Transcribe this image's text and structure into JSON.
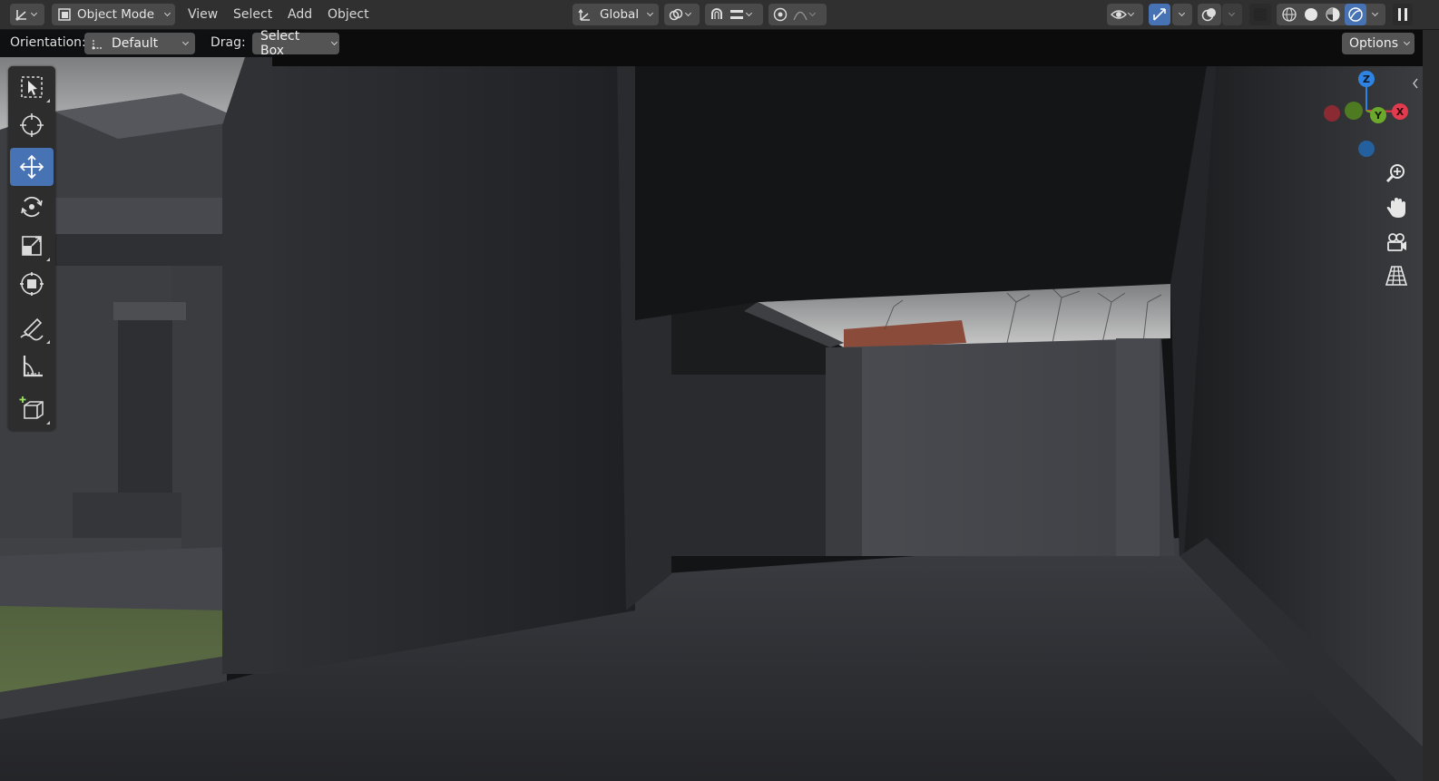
{
  "header": {
    "editor_type_icon": "axes-icon",
    "mode": "Object Mode",
    "menus": [
      "View",
      "Select",
      "Add",
      "Object"
    ],
    "transform_orientation": "Global",
    "pivot_icon": "pivot-icon",
    "snap_icon": "magnet-icon",
    "proportional_icon": "proportional-icon",
    "visibility_icon": "eye-icon",
    "gizmo_icon": "gizmo-icon",
    "overlay_icon": "overlay-icon",
    "xray_icon": "xray-icon",
    "shading_modes": [
      "wireframe",
      "solid",
      "material",
      "rendered"
    ],
    "active_shading": "rendered",
    "accent_color": "#4772b3"
  },
  "tool_settings": {
    "orientation_label": "Orientation:",
    "orientation_value": "Default",
    "drag_label": "Drag:",
    "drag_value": "Select Box",
    "options_label": "Options"
  },
  "toolbar": {
    "tools": [
      {
        "name": "select-box",
        "icon": "select-box-icon",
        "active": false
      },
      {
        "name": "cursor",
        "icon": "cursor-icon",
        "active": false
      },
      {
        "name": "move",
        "icon": "move-icon",
        "active": true
      },
      {
        "name": "rotate",
        "icon": "rotate-icon",
        "active": false
      },
      {
        "name": "scale",
        "icon": "scale-icon",
        "active": false
      },
      {
        "name": "transform",
        "icon": "transform-icon",
        "active": false
      },
      {
        "name": "annotate",
        "icon": "annotate-icon",
        "active": false
      },
      {
        "name": "measure",
        "icon": "measure-icon",
        "active": false
      },
      {
        "name": "add-cube",
        "icon": "add-cube-icon",
        "active": false
      }
    ]
  },
  "navigation": {
    "axes": {
      "z_label": "Z",
      "x_label": "X",
      "y_label": "Y",
      "z_color": "#2f83e2",
      "x_color": "#e33b4d",
      "y_color": "#6ba82b"
    },
    "buttons": [
      "zoom-icon",
      "hand-pan-icon",
      "camera-icon",
      "grid-perspective-icon"
    ]
  },
  "scene": {
    "description_colors": {
      "sky": "#b8b8b8",
      "concrete_dark": "#1a1b1d",
      "concrete_mid": "#3a3c40",
      "grass": "#5a6b43"
    }
  }
}
